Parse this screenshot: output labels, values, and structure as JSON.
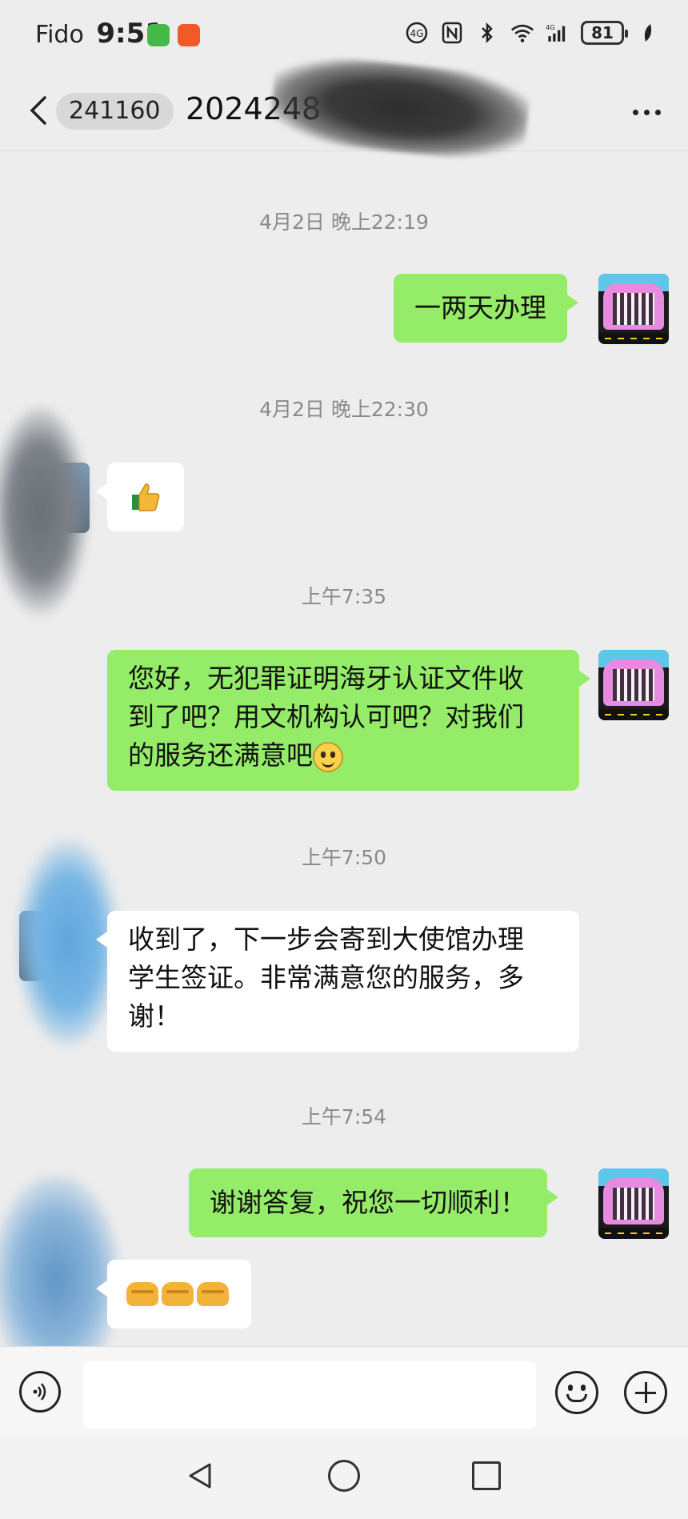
{
  "status_bar": {
    "carrier": "Fido",
    "time": "9:51",
    "battery": "81",
    "network": "4G"
  },
  "header": {
    "badge_count": "241160",
    "title": "2024248"
  },
  "messages": [
    {
      "type": "timestamp",
      "text": "4月2日 晚上22:19"
    },
    {
      "type": "sent",
      "text": "一两天办理"
    },
    {
      "type": "timestamp",
      "text": "4月2日 晚上22:30"
    },
    {
      "type": "received",
      "emoji": "thumbs-up"
    },
    {
      "type": "timestamp",
      "text": "上午7:35"
    },
    {
      "type": "sent",
      "lines": [
        "您好，无犯罪证明海牙认证文件收",
        "到了吧？用文机构认可吧？对我们",
        "的服务还满意吧"
      ],
      "emoji": "smiley"
    },
    {
      "type": "timestamp",
      "text": "上午7:50"
    },
    {
      "type": "received",
      "lines": [
        "收到了，下一步会寄到大使馆办理",
        "学生签证。非常满意您的服务，多",
        "谢！"
      ]
    },
    {
      "type": "timestamp",
      "text": "上午7:54"
    },
    {
      "type": "sent",
      "text": "谢谢答复，祝您一切顺利！"
    },
    {
      "type": "received",
      "emoji": "handshake x3"
    }
  ],
  "input": {
    "value": ""
  },
  "colors": {
    "background": "#ededed",
    "sent_bubble": "#95ec69",
    "received_bubble": "#ffffff",
    "timestamp": "#8a8a8a"
  }
}
